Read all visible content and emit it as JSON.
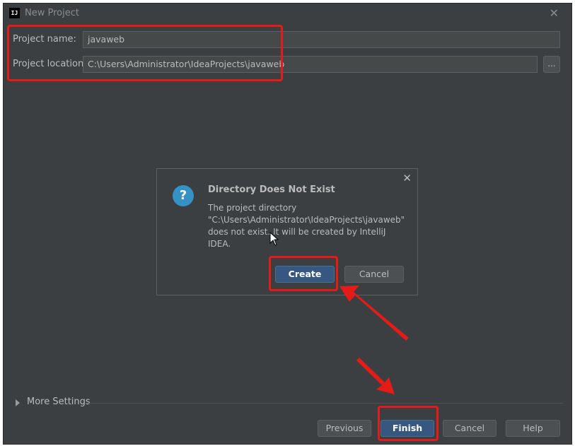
{
  "window": {
    "title": "New Project",
    "app_icon_text": "IJ",
    "close_glyph": "✕"
  },
  "form": {
    "project_name_label": "Project name:",
    "project_name_value": "javaweb",
    "project_location_label": "Project location:",
    "project_location_value": "C:\\Users\\Administrator\\IdeaProjects\\javaweb",
    "browse_label": "..."
  },
  "more_settings": {
    "label": "More Settings"
  },
  "footer_buttons": {
    "previous": "Previous",
    "finish": "Finish",
    "cancel": "Cancel",
    "help": "Help"
  },
  "dialog": {
    "title": "Directory Does Not Exist",
    "icon_glyph": "?",
    "close_glyph": "✕",
    "message_line1": "The project directory",
    "message_line2": "\"C:\\Users\\Administrator\\IdeaProjects\\javaweb\"",
    "message_line3": "does not exist. It will be created by IntelliJ",
    "message_line4": "IDEA.",
    "create_label": "Create",
    "cancel_label": "Cancel"
  },
  "colors": {
    "window_bg": "#3c3f41",
    "field_bg": "#45494a",
    "primary_button": "#365880",
    "annotation_red": "#e51b17"
  }
}
